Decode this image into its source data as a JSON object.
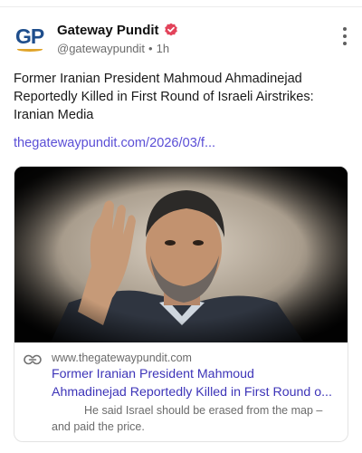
{
  "account": {
    "name": "Gateway Pundit",
    "handle": "@gatewaypundit",
    "separator": "•",
    "time": "1h",
    "avatar_text": "GP"
  },
  "post": {
    "text": "Former Iranian President Mahmoud Ahmadinejad Reportedly Killed in First Round of Israeli Airstrikes: Iranian Media",
    "link": "thegatewaypundit.com/2026/03/f..."
  },
  "card": {
    "domain": "www.thegatewaypundit.com",
    "title_line1": "Former Iranian President Mahmoud",
    "title_line2": "Ahmadinejad Reportedly Killed in First Round o...",
    "description_line1": "He said Israel should be erased from the map –",
    "description_line2": "and paid the price."
  },
  "icons": {
    "verified": "verified-badge-icon",
    "more": "more-options-icon",
    "link": "link-icon"
  },
  "colors": {
    "link": "#5b4fd6",
    "card_title": "#3d34b8",
    "verified": "#e2435a",
    "brand_blue": "#1f4e8c",
    "brand_gold": "#e0a42a"
  }
}
